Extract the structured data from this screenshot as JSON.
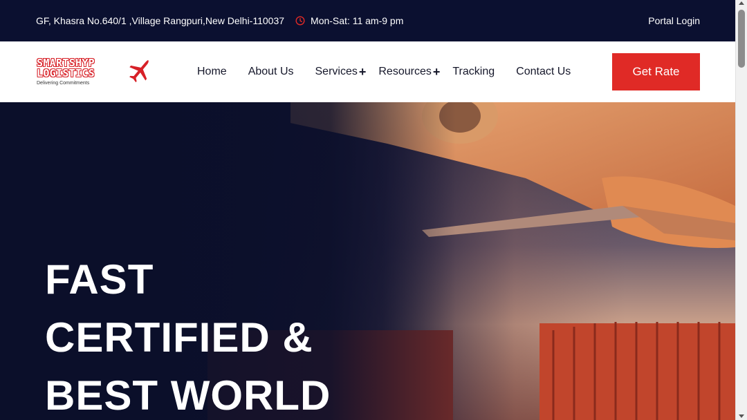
{
  "topbar": {
    "address": "GF, Khasra No.640/1 ,Village Rangpuri,New Delhi-110037",
    "hours": "Mon-Sat: 11 am-9 pm",
    "portal_login": "Portal Login",
    "clock_icon": "clock-icon"
  },
  "logo": {
    "line1": "SMARTSHYP",
    "line2": "LOGISTICS",
    "tagline": "Delivering Commitments",
    "icon": "airplane-icon",
    "brand_color": "#d72027"
  },
  "nav": {
    "items": [
      {
        "label": "Home"
      },
      {
        "label": "About Us"
      },
      {
        "label": "Services",
        "submenu_icon": "+"
      },
      {
        "label": "Resources",
        "submenu_icon": "+"
      },
      {
        "label": "Tracking"
      },
      {
        "label": "Contact Us"
      }
    ],
    "cta": "Get Rate",
    "cta_color": "#e02a26"
  },
  "hero": {
    "lines": [
      "FAST",
      "CERTIFIED &",
      "BEST WORLD"
    ]
  },
  "colors": {
    "topbar_bg": "#0b1030",
    "hero_dark": "#0b0f2a"
  }
}
